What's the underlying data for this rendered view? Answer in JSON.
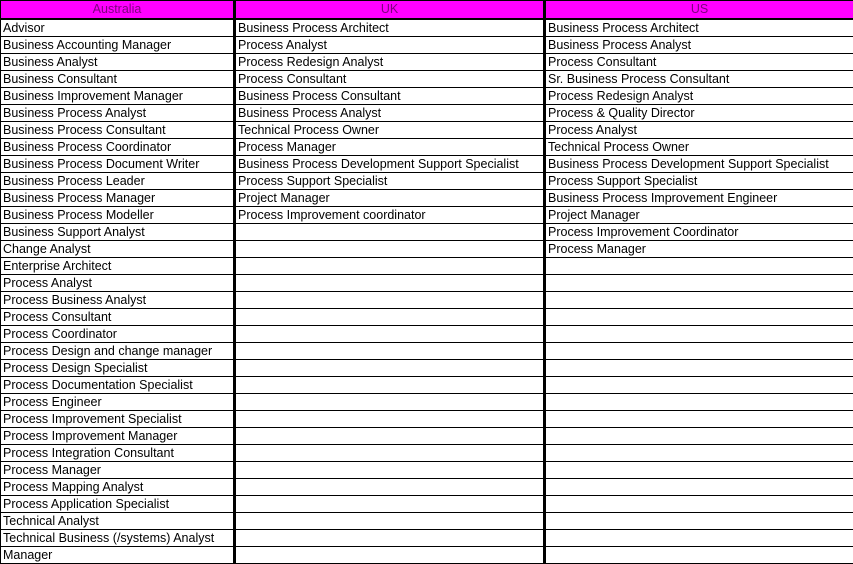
{
  "headers": [
    "Australia",
    "UK",
    "US"
  ],
  "colors": {
    "header_bg": "#ff00ff",
    "header_text": "#800080"
  },
  "columns": {
    "australia": [
      "Advisor",
      "Business Accounting Manager",
      "Business Analyst",
      "Business Consultant",
      "Business Improvement Manager",
      "Business Process Analyst",
      "Business Process Consultant",
      "Business Process Coordinator",
      "Business Process Document Writer",
      "Business Process Leader",
      "Business Process Manager",
      "Business Process Modeller",
      "Business Support Analyst",
      "Change Analyst",
      "Enterprise Architect",
      "Process Analyst",
      "Process Business Analyst",
      "Process Consultant",
      "Process Coordinator",
      "Process Design and change manager",
      "Process Design Specialist",
      "Process Documentation Specialist",
      "Process Engineer",
      "Process Improvement Specialist",
      "Process Improvement Manager",
      "Process Integration Consultant",
      "Process Manager",
      "Process Mapping Analyst",
      "Process Application Specialist",
      "Technical Analyst",
      "Technical Business (/systems) Analyst",
      "Manager"
    ],
    "uk": [
      "Business Process Architect",
      "Process Analyst",
      "Process Redesign Analyst",
      "Process Consultant",
      "Business Process Consultant",
      "Business Process Analyst",
      "Technical Process Owner",
      "Process Manager",
      "Business Process Development Support Specialist",
      "Process Support Specialist",
      "Project Manager",
      "Process Improvement coordinator"
    ],
    "us": [
      "Business Process Architect",
      "Business Process Analyst",
      "Process Consultant",
      "Sr. Business Process Consultant",
      "Process Redesign Analyst",
      "Process & Quality Director",
      "Process Analyst",
      "Technical Process Owner",
      "Business Process Development Support Specialist",
      "Process Support Specialist",
      "Business Process Improvement Engineer",
      "Project Manager",
      "Process Improvement Coordinator",
      "Process Manager"
    ]
  }
}
